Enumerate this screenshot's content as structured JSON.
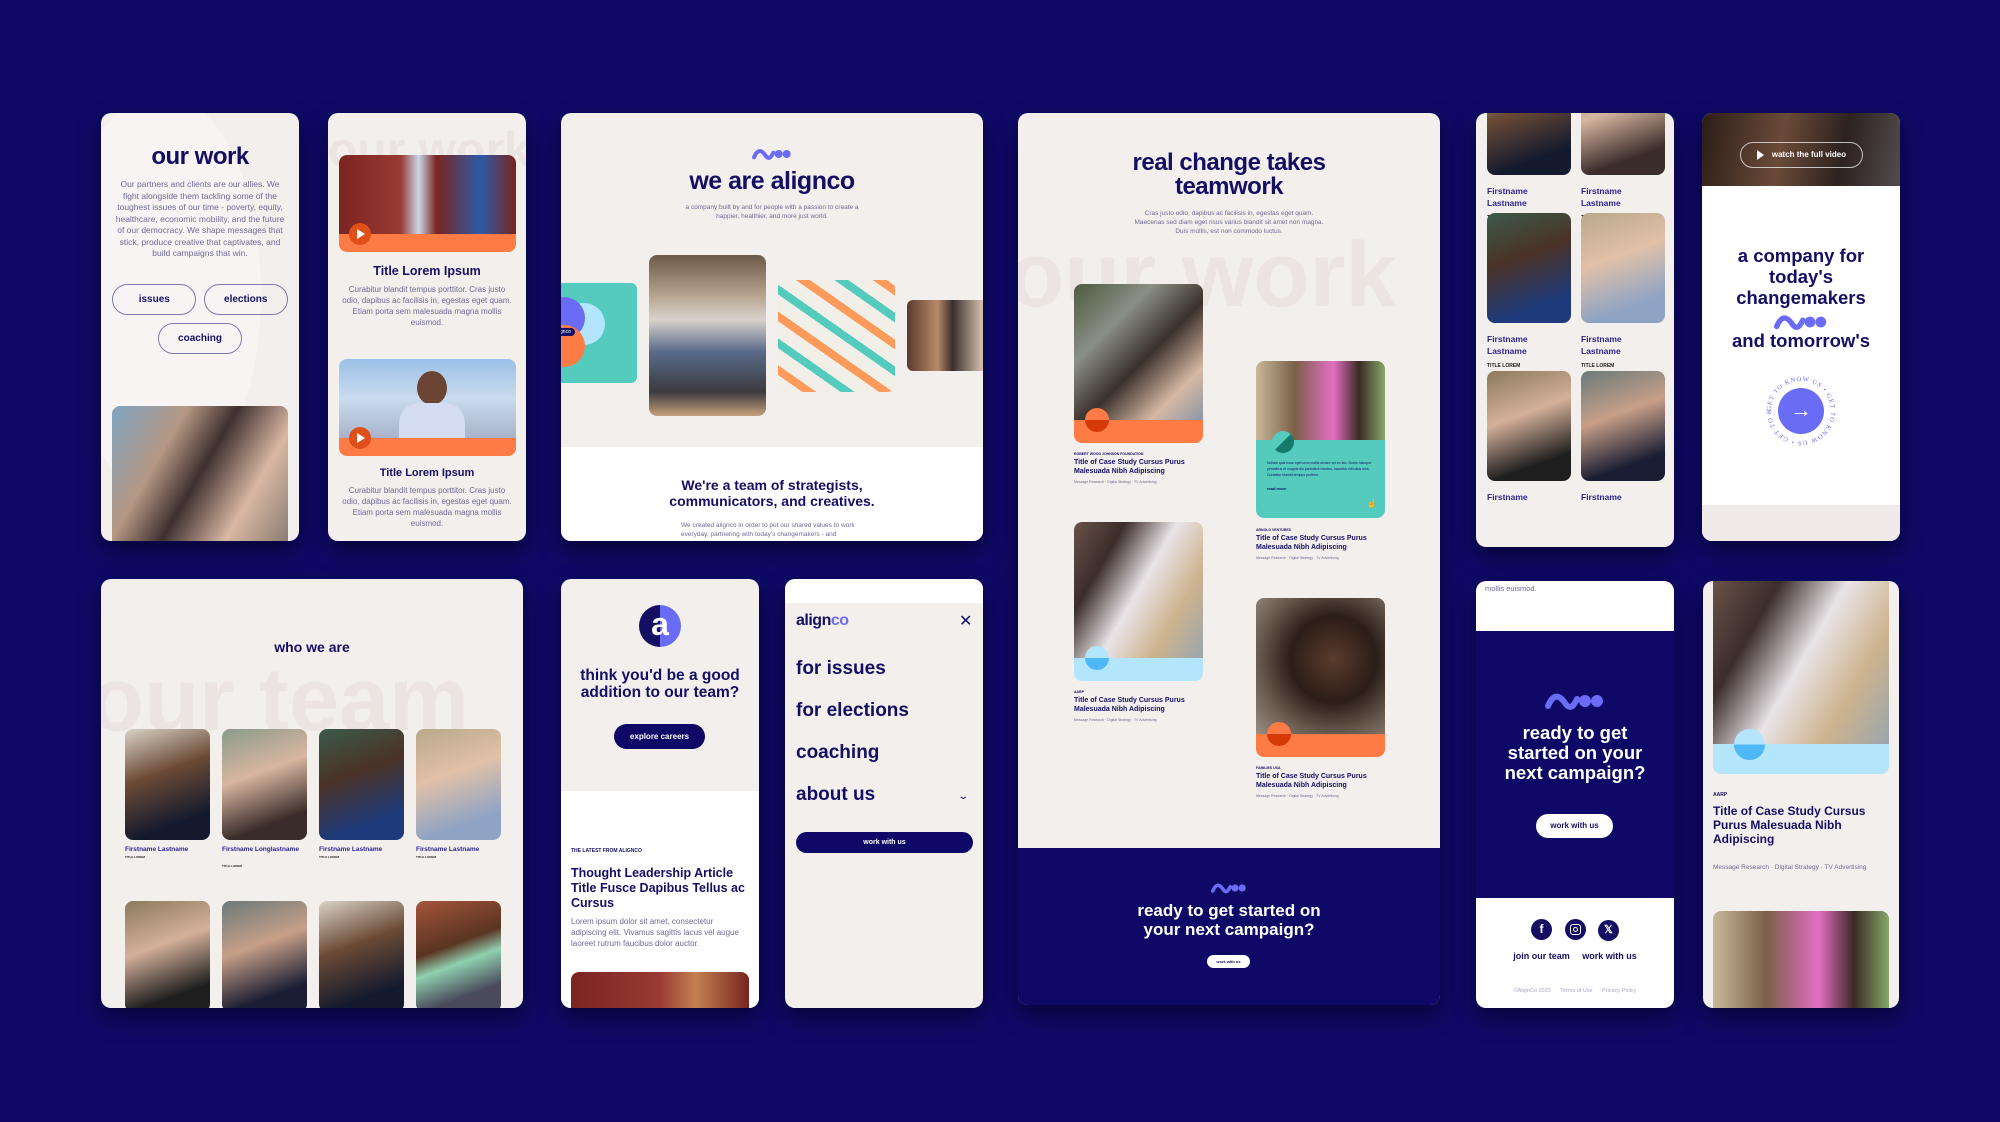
{
  "colors": {
    "background": "#0e0966",
    "navy": "#140f63",
    "card": "#f3efed",
    "accent_purple": "#6b6cf6",
    "orange": "#ff7b45",
    "teal": "#55cbbd",
    "light_blue": "#b3e6fd"
  },
  "our_work_card": {
    "title": "our work",
    "body": "Our partners and clients are our allies. We fight alongside them tackling some of the toughest issues of our time - poverty, equity, healthcare, economic mobility, and the future of our democracy. We shape messages that stick, produce creative that captivates, and build campaigns that win.",
    "tags": [
      "issues",
      "elections",
      "coaching"
    ]
  },
  "video_card": {
    "background_word": "our work",
    "items": [
      {
        "title": "Title Lorem Ipsum",
        "body": "Curabitur blandit tempus porttitor. Cras justo odio, dapibus ac facilisis in, egestas eget quam. Etiam porta sem malesuada magna mollis euismod."
      },
      {
        "title": "Title Lorem Ipsum",
        "body": "Curabitur blandit tempus porttitor. Cras justo odio, dapibus ac facilisis in, egestas eget quam. Etiam porta sem malesuada magna mollis euismod."
      }
    ]
  },
  "about_card": {
    "title": "we are alignco",
    "subtitle": "a company built by and for people with a passion to create a happier, healthier, and more just world.",
    "logo_badge": "alignco",
    "headline": "We're a team of strategists, communicators, and creatives.",
    "body": "We created alignco in order to put our shared values to work everyday, partnering with today's changemakers - and"
  },
  "case_studies_card": {
    "title": "real change takes teamwork",
    "subtitle": "Cras justo odio, dapibus ac facilisis in, egestas eget quam. Maecenas sed diam eget risus varius blandit sit amet non magna. Duis mollis, est non commodo luctus.",
    "background_word": "our work",
    "items": [
      {
        "client": "ROBERT WOOD JOHNSON FOUNDATION",
        "title": "Title of Case Study Cursus Purus Malesuada Nibh Adipiscing",
        "tags": "Message Research · Digital Strategy · TV Advertising"
      },
      {
        "client": "ARNOLD VENTURES",
        "title": "Title of Case Study Cursus Purus Malesuada Nibh Adipiscing",
        "tags": "Message Research · Digital Strategy · TV Advertising",
        "hover_text": "Nullam quis risus eget urna mollis ornare vel eu leo. Sociis natoque penatibus et magnis dis parturient montes, nascetur ridiculus mus. Curabitur blandit tempus porttitor.",
        "read_more": "read more"
      },
      {
        "client": "AARP",
        "title": "Title of Case Study Cursus Purus Malesuada Nibh Adipiscing",
        "tags": "Message Research · Digital Strategy · TV Advertising"
      },
      {
        "client": "FAMILIES USA",
        "title": "Title of Case Study Cursus Purus Malesuada Nibh Adipiscing",
        "tags": "Message Research · Digital Strategy · TV Advertising"
      }
    ],
    "cta": {
      "title": "ready to get started on your next campaign?",
      "button": "work with us"
    }
  },
  "team_mobile_card": {
    "members": [
      {
        "first": "Firstname",
        "last": "Lastname",
        "title": "TITLE LOREM"
      },
      {
        "first": "Firstname",
        "last": "Lastname",
        "title": "TITLE LOREM"
      },
      {
        "first": "Firstname",
        "last": "Lastname",
        "title": "TITLE LOREM"
      },
      {
        "first": "Firstname",
        "last": "Lastname",
        "title": "TITLE LOREM"
      },
      {
        "first": "Firstname",
        "last": "",
        "title": ""
      },
      {
        "first": "Firstname",
        "last": "",
        "title": ""
      }
    ]
  },
  "hero_mobile_card": {
    "video_button": "watch the full video",
    "line1": "a company for today's changemakers",
    "line2": "and tomorrow's",
    "circle_text": "GET TO KNOW US • GET TO KNOW US • GET TO KNOW US •"
  },
  "who_we_are_card": {
    "title": "who we are",
    "background_word": "our team",
    "members": [
      {
        "name": "Firstname Lastname",
        "title": "TITLE LOREM"
      },
      {
        "name": "Firstname Longlastname",
        "title": "TITLE LOREM"
      },
      {
        "name": "Firstname Lastname",
        "title": "TITLE LOREM"
      },
      {
        "name": "Firstname Lastname",
        "title": "TITLE LOREM"
      },
      {
        "name": "",
        "title": ""
      },
      {
        "name": "",
        "title": ""
      },
      {
        "name": "",
        "title": ""
      },
      {
        "name": "",
        "title": ""
      }
    ]
  },
  "careers_card": {
    "logo_letter": "a",
    "title": "think you'd be a good addition to our team?",
    "button": "explore careers",
    "eyebrow": "THE LATEST FROM ALIGNCO",
    "article_title": "Thought Leadership Article Title Fusce Dapibus Tellus ac Cursus",
    "article_body": "Lorem ipsum dolor sit amet, consectetur adipiscing elit. Vivamus sagittis lacus vel augue laoreet rutrum faucibus dolor auctor."
  },
  "menu_card": {
    "logo_part1": "align",
    "logo_part2": "co",
    "close_icon": "close-icon",
    "items": [
      "for issues",
      "for elections",
      "coaching",
      "about us"
    ],
    "button": "work with us"
  },
  "footer_card": {
    "top_text": "mollis euismod.",
    "cta_title": "ready to get started on your next campaign?",
    "cta_button": "work with us",
    "social": [
      "facebook-icon",
      "instagram-icon",
      "x-icon"
    ],
    "links": [
      "join our team",
      "work with us"
    ],
    "legal": [
      "©AlignCo 2023",
      "Terms of Use",
      "Privacy Policy"
    ]
  },
  "case_mobile_card": {
    "client": "AARP",
    "title": "Title of Case Study Cursus Purus Malesuada Nibh Adipiscing",
    "tags": "Message Research · Digital Strategy · TV Advertising"
  }
}
